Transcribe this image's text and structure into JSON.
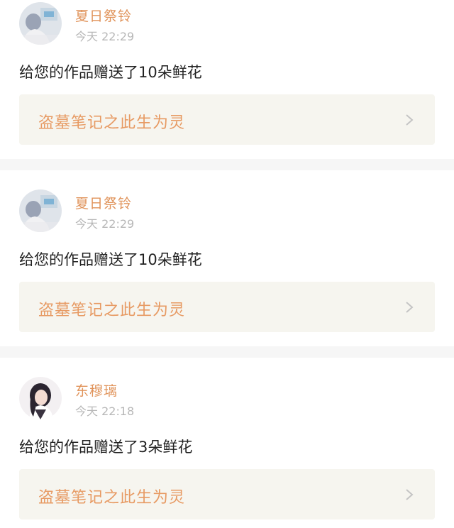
{
  "notifications": [
    {
      "username": "夏日祭铃",
      "time": "今天 22:29",
      "message": "给您的作品赠送了10朵鲜花",
      "work_title": "盗墓笔记之此生为灵",
      "avatar_icon": "user-avatar-icon"
    },
    {
      "username": "夏日祭铃",
      "time": "今天 22:29",
      "message": "给您的作品赠送了10朵鲜花",
      "work_title": "盗墓笔记之此生为灵",
      "avatar_icon": "user-avatar-icon"
    },
    {
      "username": "东穆璃",
      "time": "今天 22:18",
      "message": "给您的作品赠送了3朵鲜花",
      "work_title": "盗墓笔记之此生为灵",
      "avatar_icon": "user-avatar-icon"
    }
  ],
  "colors": {
    "username": "#e0935a",
    "work_title": "#e79a63",
    "time": "#b7b7b7",
    "message": "#222222",
    "link_bg": "#f6f5ef",
    "divider": "#f6f6f6"
  }
}
